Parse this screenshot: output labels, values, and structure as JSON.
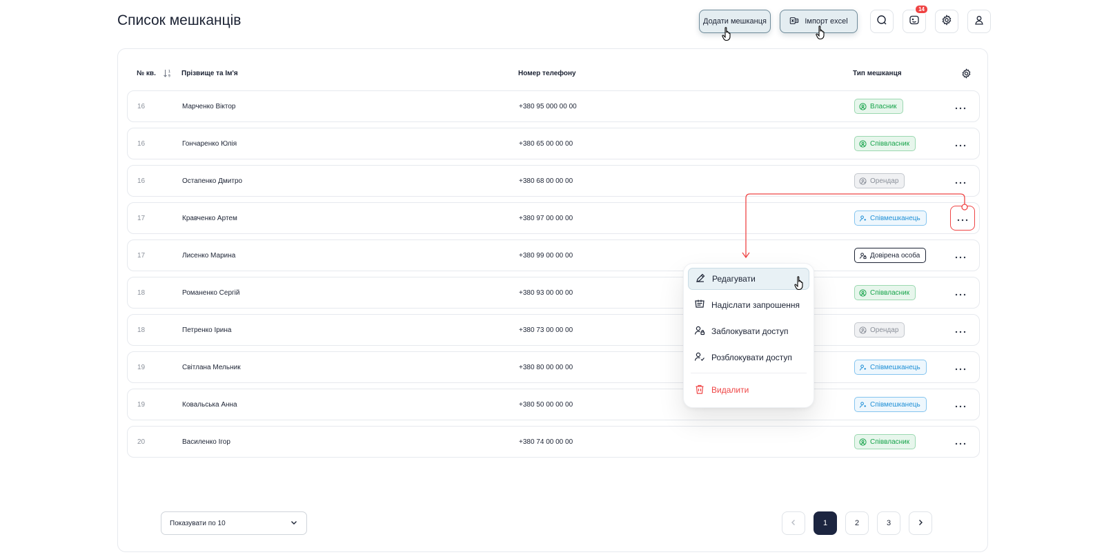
{
  "page": {
    "title": "Список мешканців"
  },
  "toolbar": {
    "add_label": "Додати мешканця",
    "import_label": "Імпорт excel",
    "notifications_count": "14"
  },
  "table": {
    "headers": {
      "apt": "№ кв.",
      "name": "Прізвище та Ім'я",
      "phone": "Номер телефону",
      "type": "Тип мешканця"
    },
    "rows": [
      {
        "apt": "16",
        "name": "Марченко Віктор",
        "phone": "+380 95 000 00 00",
        "type": "Власник",
        "kind": "owner"
      },
      {
        "apt": "16",
        "name": "Гончаренко Юлія",
        "phone": "+380 65 00 00 00",
        "type": "Співвласник",
        "kind": "owner"
      },
      {
        "apt": "16",
        "name": "Остапенко Дмитро",
        "phone": "+380 68 00 00 00",
        "type": "Орендар",
        "kind": "tenant"
      },
      {
        "apt": "17",
        "name": "Кравченко Артем",
        "phone": "+380 97 00 00 00",
        "type": "Співмешканець",
        "kind": "resident"
      },
      {
        "apt": "17",
        "name": "Лисенко Марина",
        "phone": "+380 99 00 00 00",
        "type": "Довірена особа",
        "kind": "trusted"
      },
      {
        "apt": "18",
        "name": "Романенко Сергій",
        "phone": "+380 93 00 00 00",
        "type": "Співвласник",
        "kind": "owner"
      },
      {
        "apt": "18",
        "name": "Петренко Ірина",
        "phone": "+380 73 00 00 00",
        "type": "Орендар",
        "kind": "tenant"
      },
      {
        "apt": "19",
        "name": "Світлана Мельник",
        "phone": "+380 80 00 00 00",
        "type": "Співмешканець",
        "kind": "resident"
      },
      {
        "apt": "19",
        "name": "Ковальська Анна",
        "phone": "+380 50 00 00 00",
        "type": "Співмешканець",
        "kind": "resident"
      },
      {
        "apt": "20",
        "name": "Василенко Ігор",
        "phone": "+380 74 00 00 00",
        "type": "Співвласник",
        "kind": "owner"
      }
    ]
  },
  "context_menu": {
    "items": [
      {
        "label": "Редагувати",
        "icon": "pencil-icon"
      },
      {
        "label": "Надіслати запрошення",
        "icon": "invite-icon"
      },
      {
        "label": "Заблокувати доступ",
        "icon": "user-lock-icon"
      },
      {
        "label": "Розблокувати доступ",
        "icon": "user-check-icon"
      }
    ],
    "delete_label": "Видалити"
  },
  "pagination": {
    "per_page_label": "Показувати по 10",
    "pages": [
      "1",
      "2",
      "3"
    ],
    "current": "1"
  },
  "colors": {
    "accent": "#1c2540",
    "danger": "#ef4444",
    "owner": "#16a34a",
    "resident": "#1e8fd6",
    "tenant": "#8a8f99"
  }
}
